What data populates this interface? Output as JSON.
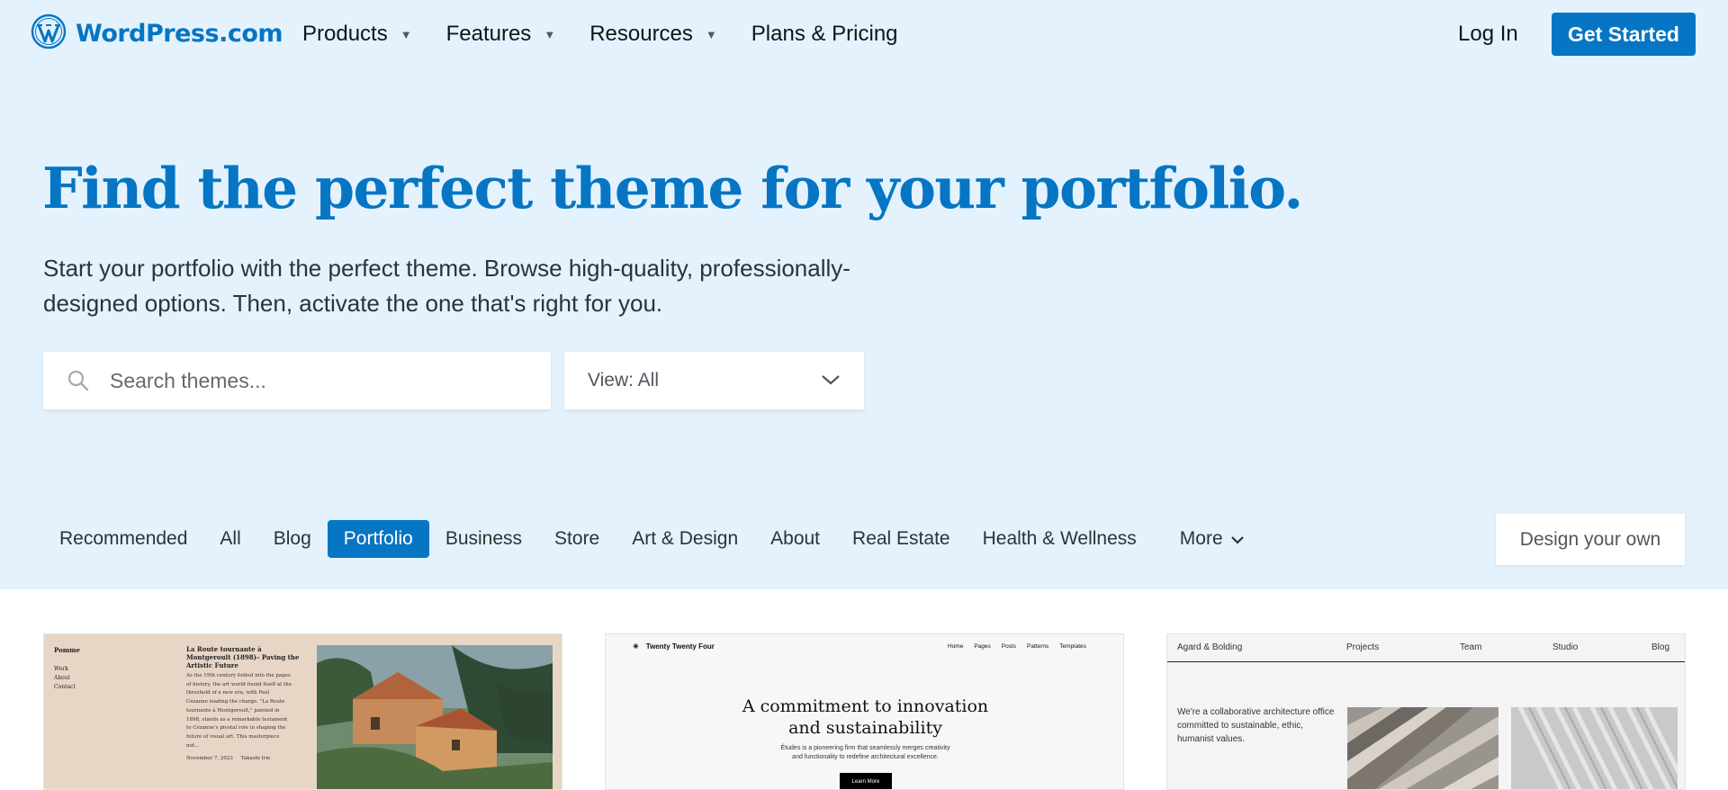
{
  "header": {
    "logo_text": "WordPress.com",
    "nav": [
      {
        "label": "Products",
        "dropdown": true
      },
      {
        "label": "Features",
        "dropdown": true
      },
      {
        "label": "Resources",
        "dropdown": true
      },
      {
        "label": "Plans & Pricing",
        "dropdown": false
      }
    ],
    "login_label": "Log In",
    "cta_label": "Get Started"
  },
  "hero": {
    "title": "Find the perfect theme for your portfolio.",
    "subtitle_line1": "Start your portfolio with the perfect theme. Browse high-quality, professionally-",
    "subtitle_line2": "designed options. Then, activate the one that's right for you.",
    "search_placeholder": "Search themes...",
    "view_select": "View: All"
  },
  "categories": {
    "items": [
      "Recommended",
      "All",
      "Blog",
      "Portfolio",
      "Business",
      "Store",
      "Art & Design",
      "About",
      "Real Estate",
      "Health & Wellness"
    ],
    "active": "Portfolio",
    "more_label": "More",
    "design_own_label": "Design your own"
  },
  "cards": {
    "card1": {
      "brand": "Pomme",
      "menu": [
        "Work",
        "About",
        "Contact"
      ],
      "headline": "La Route tournante à Montgeroult (1898)– Paving the Artistic Future",
      "body": "As the 19th century folded into the pages of history, the art world found itself at the threshold of a new era, with Paul Cézanne leading the charge. \"La Route tournante à Montgeroult,\" painted in 1898, stands as a remarkable testament to Cézanne's pivotal role in shaping the future of visual art. This masterpiece not...",
      "date": "November 7, 2023",
      "author": "Takashi Irie"
    },
    "card2": {
      "brand": "Twenty Twenty Four",
      "brand_glyph": "✳",
      "nav": [
        "Home",
        "Pages",
        "Posts",
        "Patterns",
        "Templates"
      ],
      "headline_line1": "A commitment to innovation",
      "headline_line2": "and sustainability",
      "sub_line1": "Études is a pioneering firm that seamlessly merges creativity",
      "sub_line2": "and functionality to redefine architectural excellence.",
      "button": "Learn More"
    },
    "card3": {
      "brand": "Agard & Bolding",
      "nav": [
        "Projects",
        "Team",
        "Studio",
        "Blog"
      ],
      "text": "We're a collaborative architecture office committed to sustainable, ethic, humanist values."
    }
  },
  "colors": {
    "brand_blue": "#0675c4",
    "hero_bg": "#e3f2fd",
    "text_dark": "#101517"
  }
}
